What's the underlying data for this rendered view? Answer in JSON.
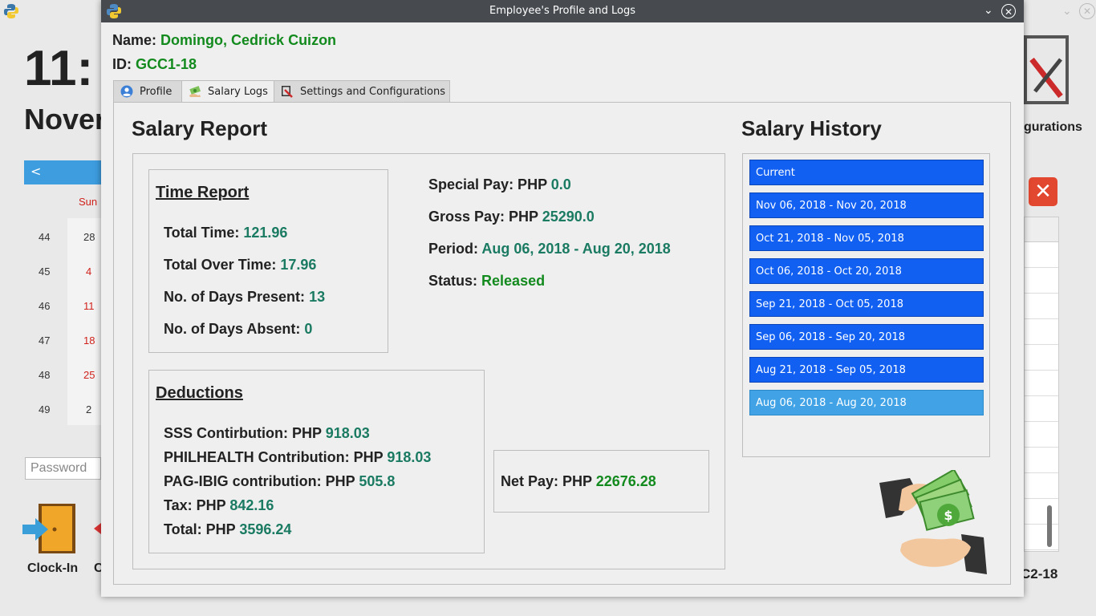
{
  "background": {
    "clock_partial": "11:",
    "date_partial": "Nover",
    "calendar": {
      "header_day": "Sun",
      "weeks": [
        "44",
        "45",
        "46",
        "47",
        "48",
        "49"
      ],
      "sundays": [
        "28",
        "4",
        "11",
        "18",
        "25",
        "2"
      ]
    },
    "password_placeholder": "Password",
    "clock_in_label": "Clock-In",
    "clock_out_partial": "C",
    "configurations_partial": "gurations",
    "employee_id_partial": "C2-18"
  },
  "window": {
    "title": "Employee's Profile and Logs",
    "name_label": "Name:",
    "name_value": "Domingo, Cedrick Cuizon",
    "id_label": "ID:",
    "id_value": "GCC1-18"
  },
  "tabs": [
    {
      "label": "Profile",
      "icon": "user-icon",
      "active": false
    },
    {
      "label": "Salary Logs",
      "icon": "money-icon",
      "active": true
    },
    {
      "label": "Settings and Configurations",
      "icon": "tools-icon",
      "active": false
    }
  ],
  "salary_report": {
    "title": "Salary Report",
    "time_report": {
      "title": "Time Report",
      "total_time_label": "Total Time:",
      "total_time_value": "121.96",
      "total_overtime_label": "Total Over Time:",
      "total_overtime_value": "17.96",
      "days_present_label": "No. of Days Present:",
      "days_present_value": "13",
      "days_absent_label": "No. of Days Absent:",
      "days_absent_value": "0"
    },
    "summary": {
      "special_pay_label": "Special Pay: PHP",
      "special_pay_value": "0.0",
      "gross_pay_label": "Gross Pay: PHP",
      "gross_pay_value": "25290.0",
      "period_label": "Period:",
      "period_value": "Aug 06, 2018 - Aug 20, 2018",
      "status_label": "Status:",
      "status_value": "Released"
    },
    "deductions": {
      "title": "Deductions",
      "sss_label": "SSS Contirbution: PHP",
      "sss_value": "918.03",
      "philhealth_label": "PHILHEALTH Contribution: PHP",
      "philhealth_value": "918.03",
      "pagibig_label": "PAG-IBIG contribution: PHP",
      "pagibig_value": "505.8",
      "tax_label": "Tax: PHP",
      "tax_value": "842.16",
      "total_label": "Total: PHP",
      "total_value": "3596.24"
    },
    "net_pay_label": "Net Pay: PHP",
    "net_pay_value": "22676.28"
  },
  "salary_history": {
    "title": "Salary History",
    "items": [
      "Current",
      "Nov 06, 2018 - Nov 20, 2018",
      "Oct 21, 2018 - Nov 05, 2018",
      "Oct 06, 2018 - Oct 20, 2018",
      "Sep 21, 2018 - Oct 05, 2018",
      "Sep 06, 2018 - Sep 20, 2018",
      "Aug 21, 2018 - Sep 05, 2018",
      "Aug 06, 2018 - Aug 20, 2018"
    ],
    "selected": "Aug 06, 2018 - Aug 20, 2018"
  },
  "colors": {
    "value_green": "#138a1e",
    "value_teal": "#1a7a62",
    "history_item": "#1160f2",
    "history_selected": "#41a3e6",
    "titlebar": "#474b50"
  }
}
